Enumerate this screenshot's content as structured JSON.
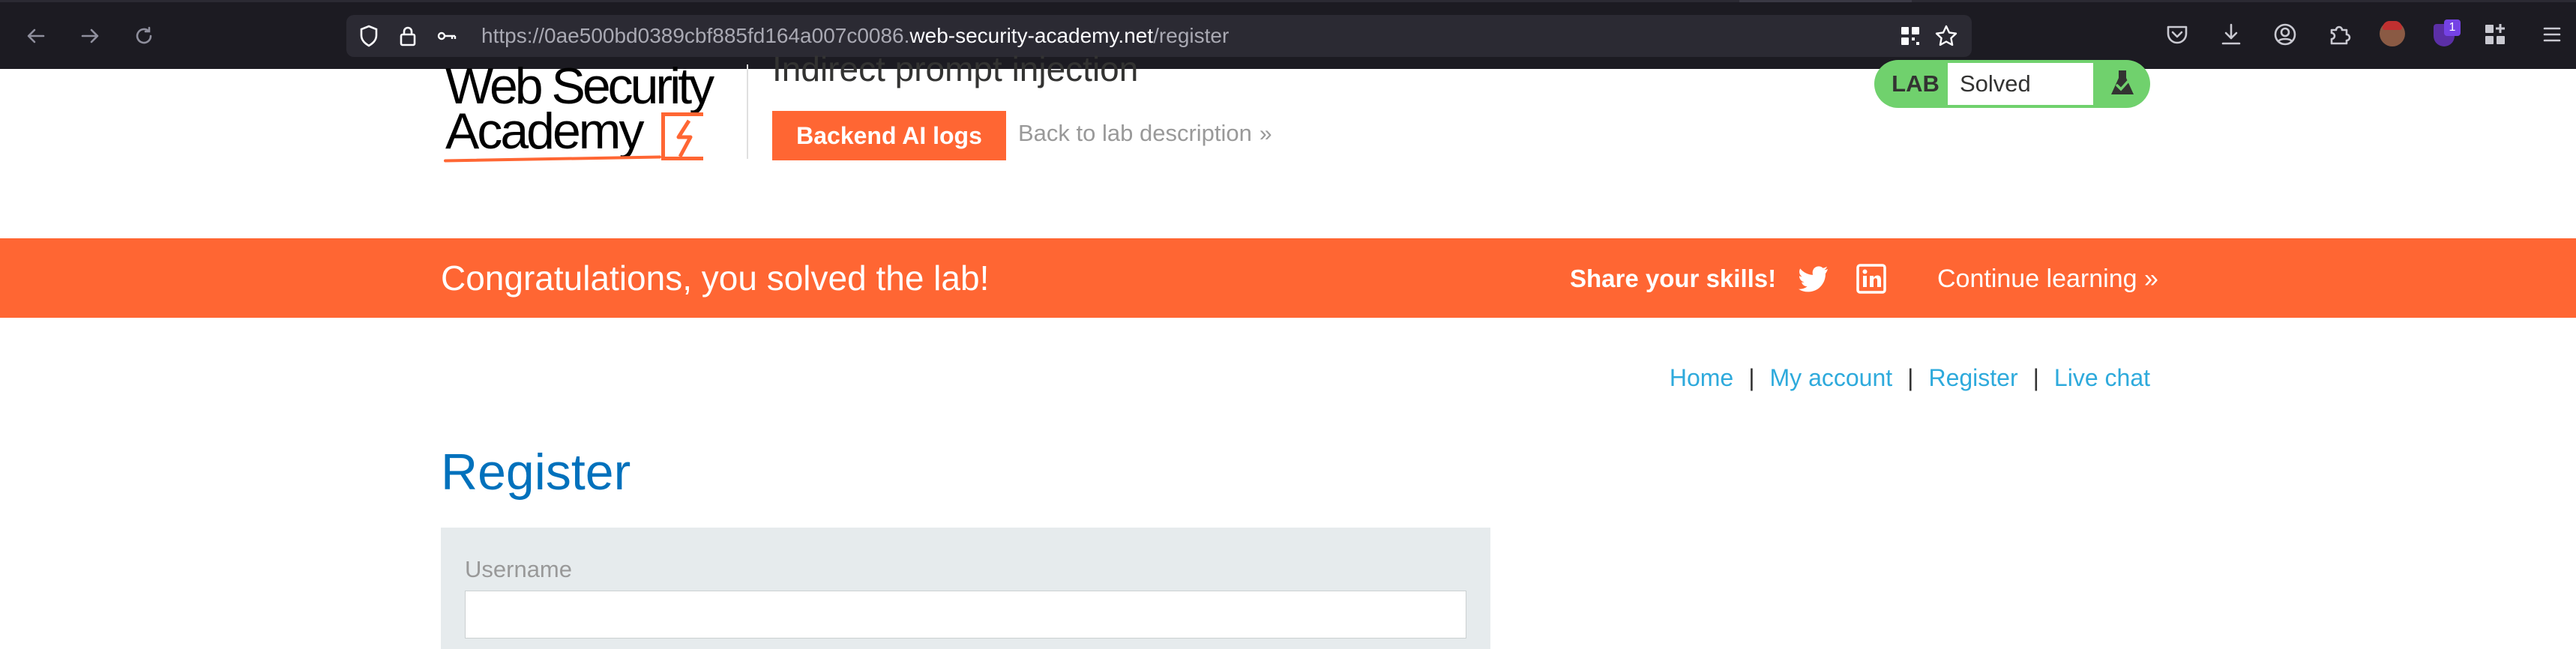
{
  "browser": {
    "url_prefix": "https://0ae500bd0389cbf885fd164a007c0086.",
    "url_host": "web-security-academy.net",
    "url_path": "/register",
    "extension_badge": "1"
  },
  "header": {
    "logo_line1": "Web Security",
    "logo_line2": "Academy",
    "lab_title": "Indirect prompt injection",
    "backend_button": "Backend AI logs",
    "back_link": "Back to lab description",
    "lab_label": "LAB",
    "lab_status": "Solved"
  },
  "banner": {
    "message": "Congratulations, you solved the lab!",
    "share": "Share your skills!",
    "continue": "Continue learning"
  },
  "nav": {
    "items": [
      "Home",
      "My account",
      "Register",
      "Live chat"
    ],
    "separator": "|"
  },
  "page": {
    "heading": "Register",
    "username_label": "Username",
    "username_value": ""
  },
  "colors": {
    "accent": "#ff6633",
    "link": "#2eaadc",
    "heading": "#0071bc",
    "lab_green": "#70d16d"
  }
}
